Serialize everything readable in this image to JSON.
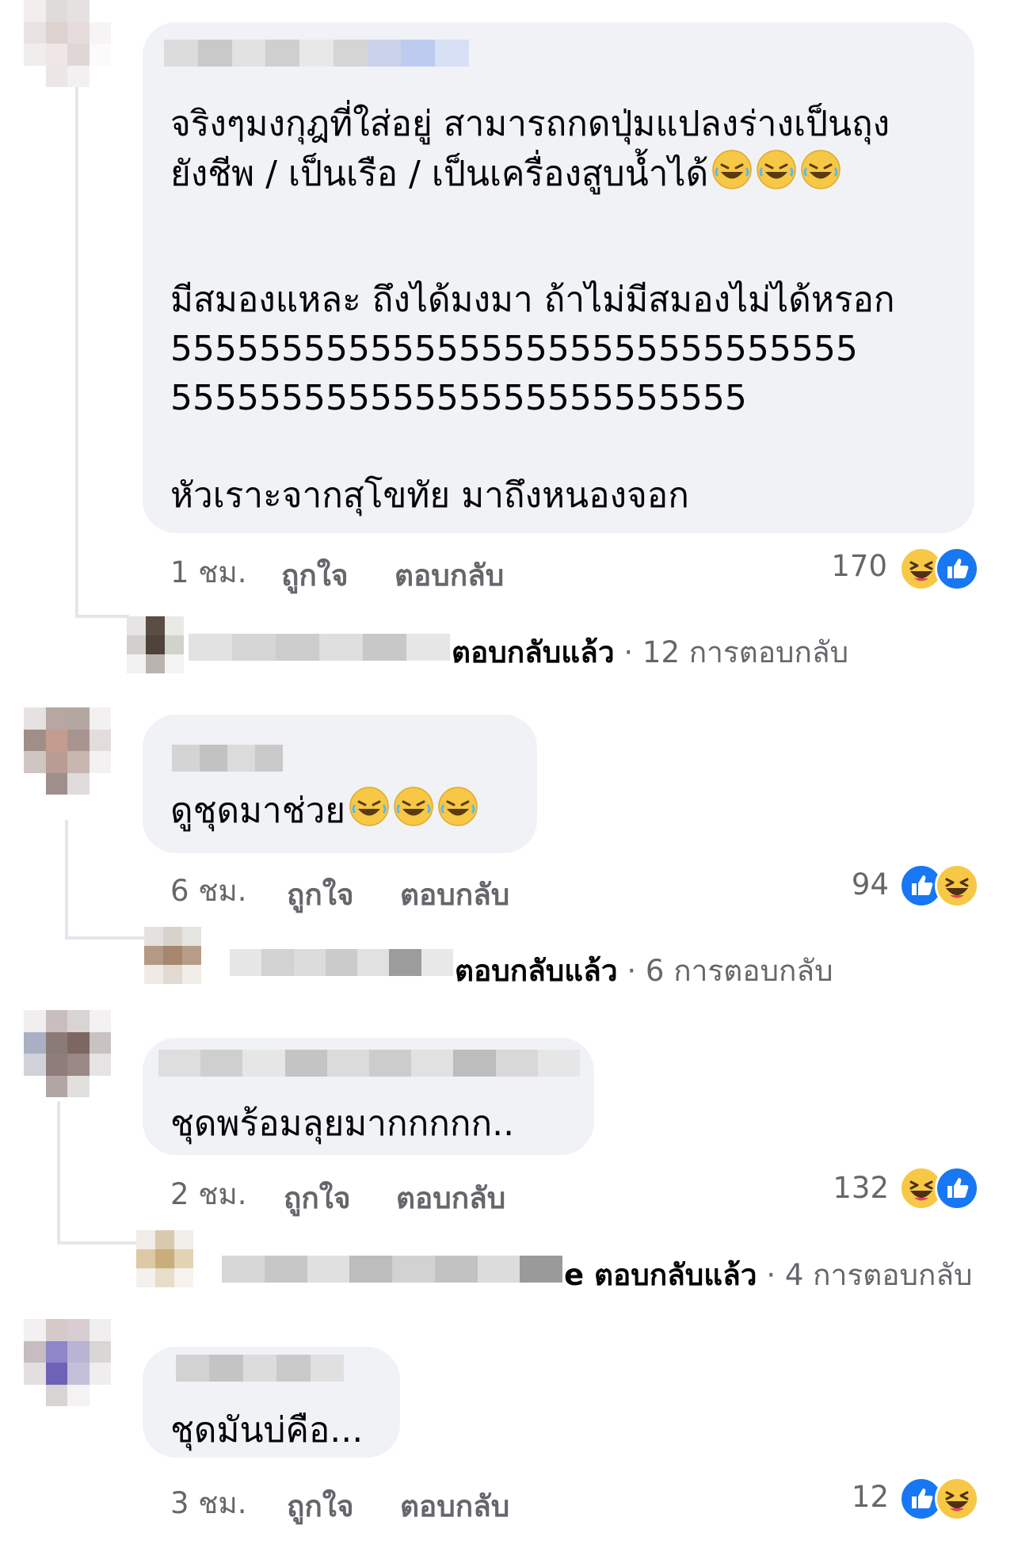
{
  "comments": [
    {
      "text": "จริงๆมงกุฎที่ใส่อยู่ สามารถกดปุ่มแปลงร่างเป็นถุง\nยังชีพ / เป็นเรือ / เป็นเครื่องสูบน้ำได้",
      "text2": "มีสมองแหละ ถึงได้มงมา ถ้าไม่มีสมองไม่ได้หรอก\n5555555555555555555555555555555\n55555555555555555555555555",
      "text3": "หัวเราะจากสุโขทัย มาถึงหนองจอก",
      "time": "1 ชม.",
      "like_label": "ถูกใจ",
      "reply_label": "ตอบกลับ",
      "reaction_count": "170",
      "reactions": [
        "haha-icon",
        "like-icon"
      ],
      "replied_label": "ตอบกลับแล้ว",
      "reply_count": "· 12 การตอบกลับ"
    },
    {
      "text": "ดูชุดมาช่วย",
      "time": "6 ชม.",
      "like_label": "ถูกใจ",
      "reply_label": "ตอบกลับ",
      "reaction_count": "94",
      "reactions": [
        "like-icon",
        "haha-icon"
      ],
      "replied_label": "ตอบกลับแล้ว",
      "reply_count": "· 6 การตอบกลับ"
    },
    {
      "text": "ชุดพร้อมลุยมากกกกก..",
      "time": "2 ชม.",
      "like_label": "ถูกใจ",
      "reply_label": "ตอบกลับ",
      "reaction_count": "132",
      "reactions": [
        "haha-icon",
        "like-icon"
      ],
      "replied_label": "e ตอบกลับแล้ว",
      "reply_count": "· 4 การตอบกลับ"
    },
    {
      "text": "ชุดมันบ่คือ...",
      "time": "3 ชม.",
      "like_label": "ถูกใจ",
      "reply_label": "ตอบกลับ",
      "reaction_count": "12",
      "reactions": [
        "like-icon",
        "haha-icon"
      ]
    }
  ],
  "colors": {
    "bubble": "#f0f2f5",
    "secondary_text": "#65676b",
    "like_blue": "#1877f2",
    "haha_yellow": "#f7c846"
  }
}
